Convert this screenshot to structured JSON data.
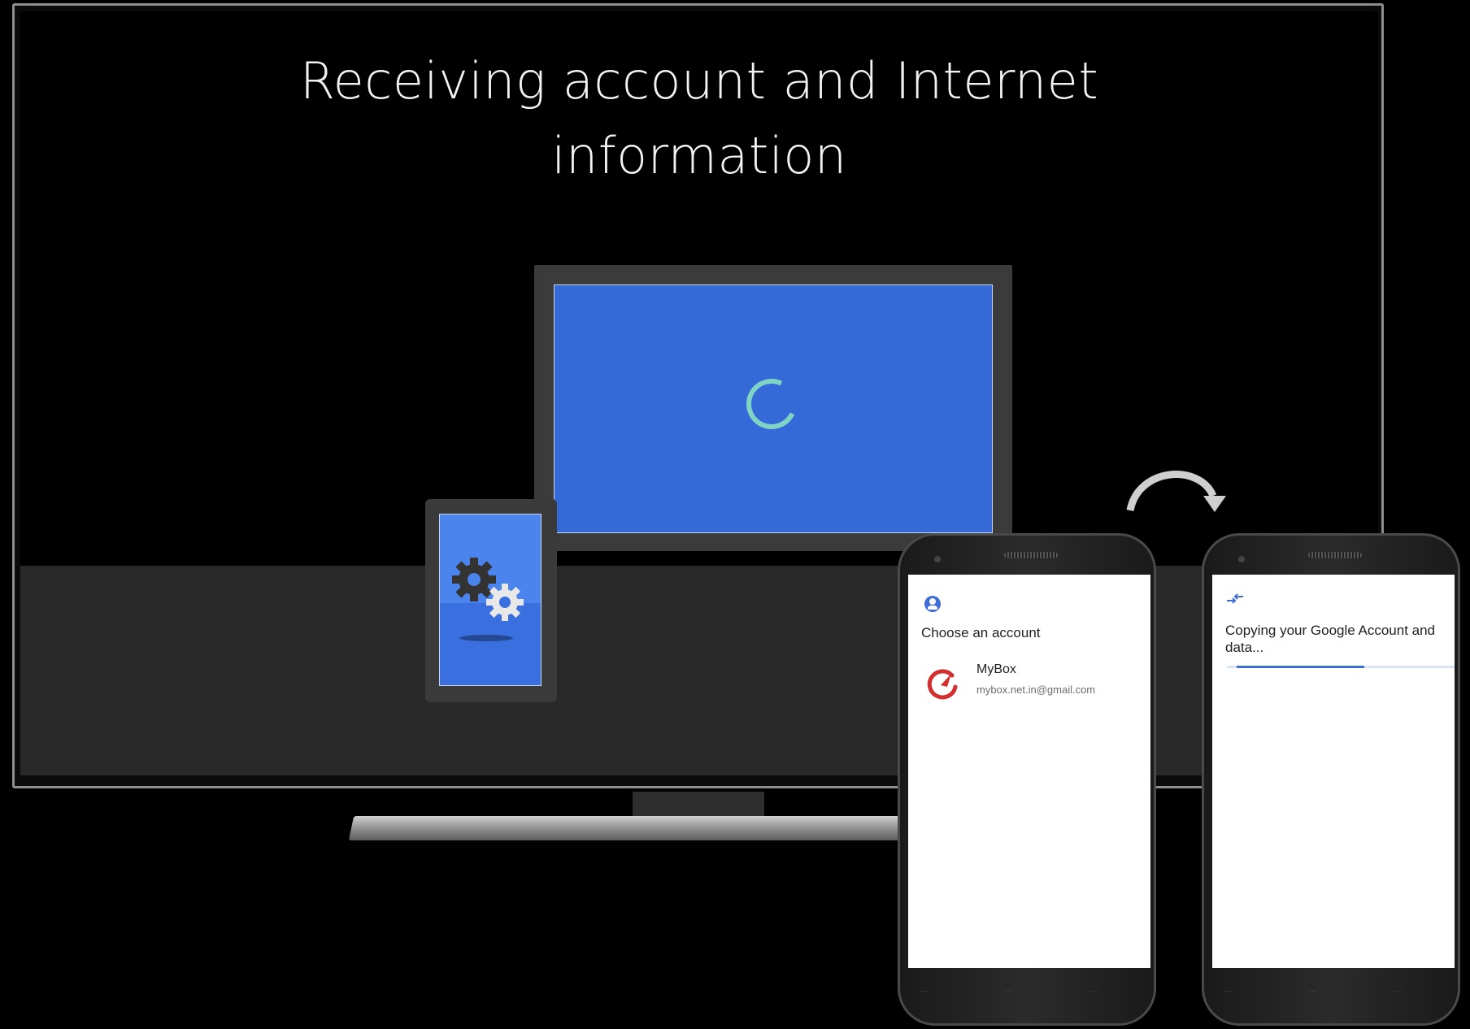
{
  "tv": {
    "title_line1": "Receiving account and Internet",
    "title_line2": "information"
  },
  "phone1": {
    "title": "Choose an account",
    "account_name": "MyBox",
    "account_email": "mybox.net.in@gmail.com"
  },
  "phone2": {
    "title": "Copying your Google Account and data...",
    "progress": 0.56
  },
  "colors": {
    "monitor_screen": "#3669d8",
    "spinner": "#7fd4c6",
    "accent": "#3f6fd6",
    "logo_red": "#d32f2f"
  },
  "icons": [
    "loading-spinner-icon",
    "gears-icon",
    "arc-arrow-icon",
    "account-circle-icon",
    "mybox-logo-icon",
    "transfer-arrows-icon"
  ]
}
